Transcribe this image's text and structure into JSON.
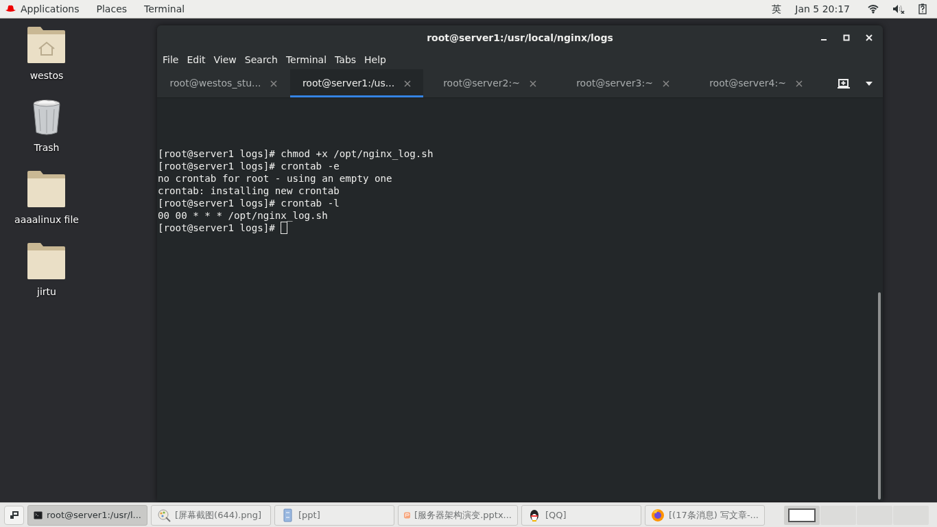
{
  "top_bar": {
    "menus": [
      "Applications",
      "Places",
      "Terminal"
    ],
    "input_method": "英",
    "clock": "Jan 5  20:17"
  },
  "desktop_icons": [
    {
      "label": "westos",
      "kind": "home"
    },
    {
      "label": "Trash",
      "kind": "trash"
    },
    {
      "label": "aaaalinux file",
      "kind": "folder"
    },
    {
      "label": "jirtu",
      "kind": "folder"
    }
  ],
  "window": {
    "title": "root@server1:/usr/local/nginx/logs",
    "menu": [
      "File",
      "Edit",
      "View",
      "Search",
      "Terminal",
      "Tabs",
      "Help"
    ],
    "tabs": [
      {
        "label": "root@westos_stu...",
        "selected": false
      },
      {
        "label": "root@server1:/us...",
        "selected": true
      },
      {
        "label": "root@server2:~",
        "selected": false
      },
      {
        "label": "root@server3:~",
        "selected": false
      },
      {
        "label": "root@server4:~",
        "selected": false
      }
    ],
    "lines": [
      "[root@server1 logs]# chmod +x /opt/nginx_log.sh",
      "[root@server1 logs]# crontab -e",
      "no crontab for root - using an empty one",
      "crontab: installing new crontab",
      "[root@server1 logs]# crontab -l",
      "00 00 * * * /opt/nginx_log.sh",
      "[root@server1 logs]# "
    ]
  },
  "taskbar": {
    "items": [
      {
        "label": "root@server1:/usr/l...",
        "kind": "terminal",
        "selected": true
      },
      {
        "label": "[屏幕截图(644).png]",
        "kind": "image",
        "selected": false
      },
      {
        "label": "[ppt]",
        "kind": "files",
        "selected": false
      },
      {
        "label": "[服务器架构演变.pptx...",
        "kind": "slides",
        "selected": false
      },
      {
        "label": "[QQ]",
        "kind": "qq",
        "selected": false
      },
      {
        "label": "[(17条消息) 写文章-...",
        "kind": "browser",
        "selected": false
      }
    ],
    "workspaces": [
      {
        "selected": true
      },
      {
        "selected": false
      },
      {
        "selected": false
      },
      {
        "selected": false
      }
    ]
  }
}
